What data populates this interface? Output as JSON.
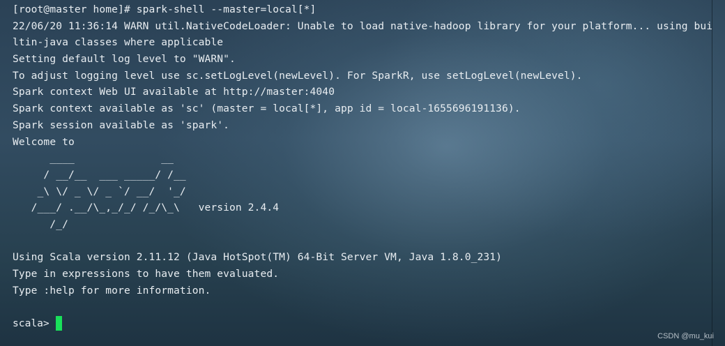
{
  "terminal": {
    "lines": [
      "[root@master home]# spark-shell --master=local[*]",
      "22/06/20 11:36:14 WARN util.NativeCodeLoader: Unable to load native-hadoop library for your platform... using bui",
      "ltin-java classes where applicable",
      "Setting default log level to \"WARN\".",
      "To adjust logging level use sc.setLogLevel(newLevel). For SparkR, use setLogLevel(newLevel).",
      "Spark context Web UI available at http://master:4040",
      "Spark context available as 'sc' (master = local[*], app id = local-1655696191136).",
      "Spark session available as 'spark'.",
      "Welcome to",
      "      ____              __",
      "     / __/__  ___ _____/ /__",
      "    _\\ \\/ _ \\/ _ `/ __/  '_/",
      "   /___/ .__/\\_,_/_/ /_/\\_\\   version 2.4.4",
      "      /_/",
      "",
      "Using Scala version 2.11.12 (Java HotSpot(TM) 64-Bit Server VM, Java 1.8.0_231)",
      "Type in expressions to have them evaluated.",
      "Type :help for more information."
    ],
    "prompt": "scala>",
    "cursor_color": "#19e05a"
  },
  "watermark": "CSDN @mu_kui"
}
